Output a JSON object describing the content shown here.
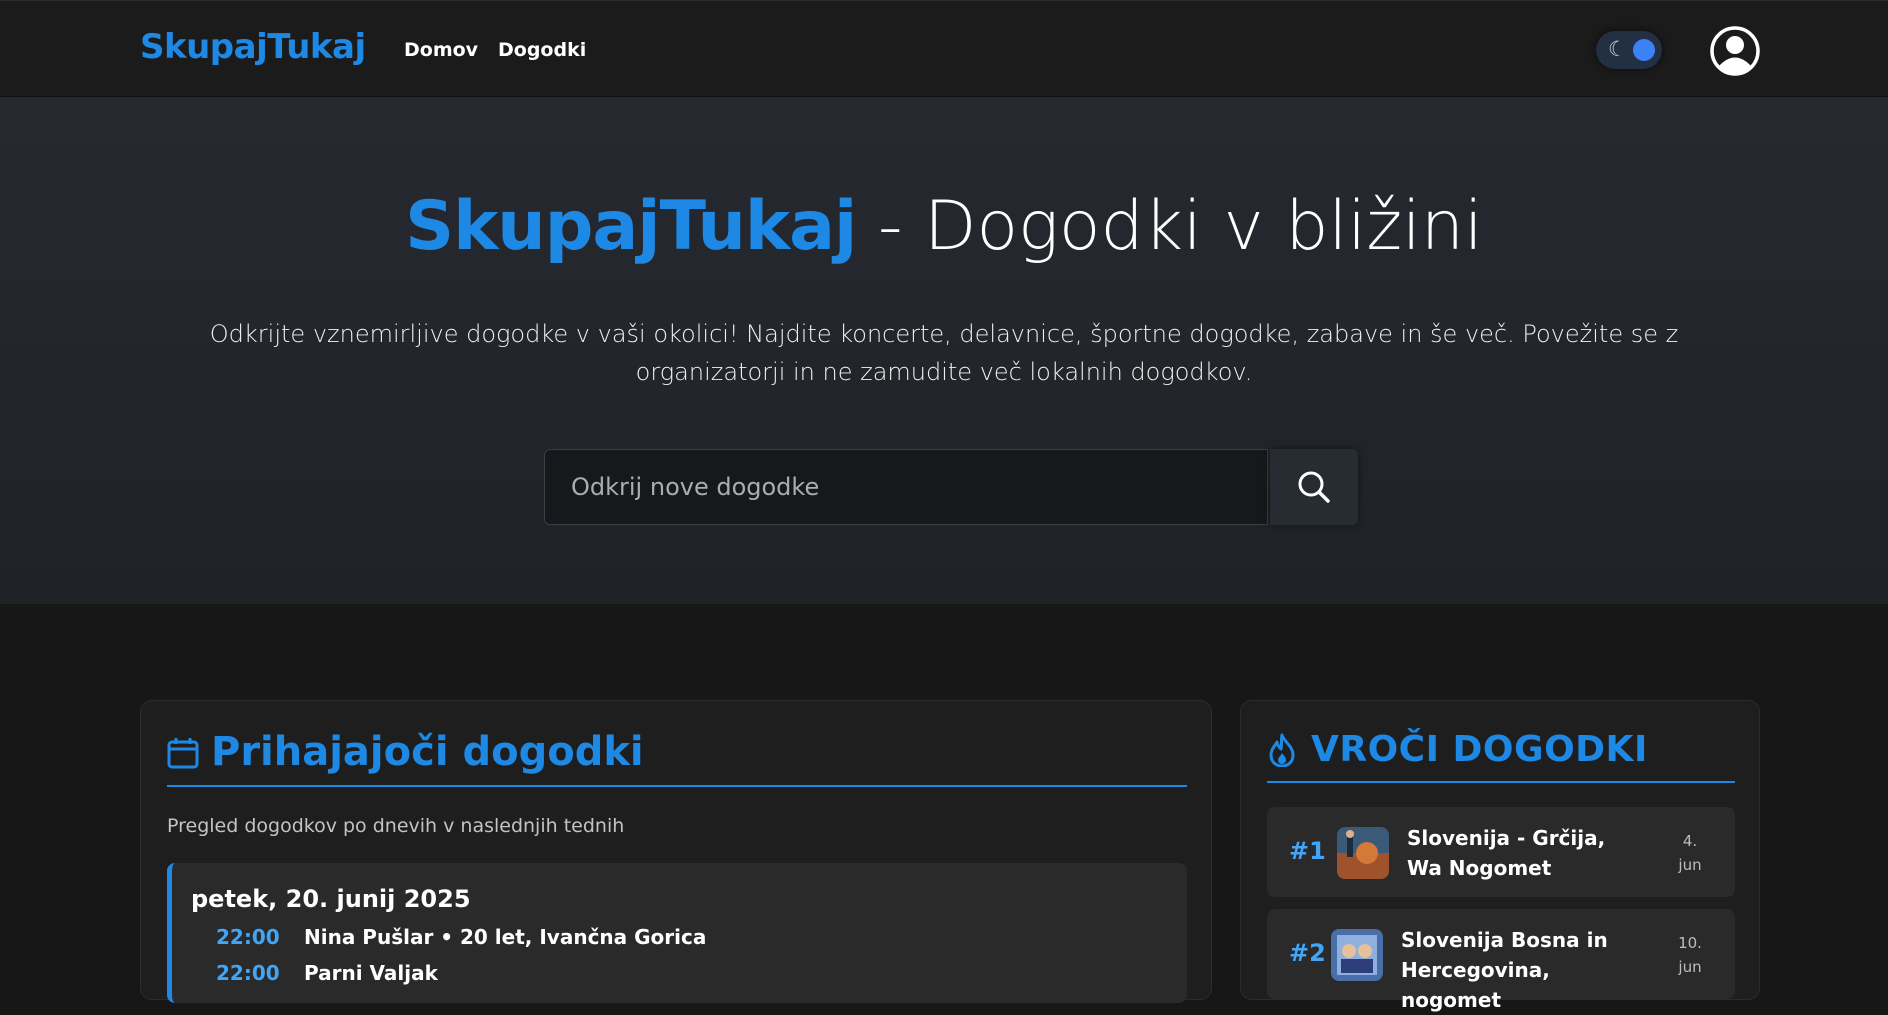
{
  "navbar": {
    "brand": "SkupajTukaj",
    "links": [
      "Domov",
      "Dogodki"
    ],
    "theme_toggle_icon": "moon-icon",
    "user_icon": "user-circle-icon"
  },
  "hero": {
    "title_brand": "SkupajTukaj",
    "title_rest": " - Dogodki v bližini",
    "description": "Odkrijte vznemirljive dogodke v vaši okolici! Najdite koncerte, delavnice, športne dogodke, zabave in še več. Povežite se z organizatorji in ne zamudite več lokalnih dogodkov.",
    "search_placeholder": "Odkrij nove dogodke",
    "search_button_icon": "search-icon"
  },
  "upcoming": {
    "title": "Prihajajoči dogodki",
    "icon": "calendar-icon",
    "subtitle": "Pregled dogodkov po dnevih v naslednjih tednih",
    "days": [
      {
        "date": "petek, 20. junij 2025",
        "events": [
          {
            "time": "22:00",
            "name": "Nina Pušlar • 20 let, Ivančna Gorica"
          },
          {
            "time": "22:00",
            "name": "Parni Valjak"
          }
        ]
      }
    ]
  },
  "hot": {
    "title": "VROČI DOGODKI",
    "icon": "flame-icon",
    "items": [
      {
        "rank": "#1",
        "name": "Slovenija - Grčija, Wa Nogomet",
        "day": "4.",
        "month": "jun"
      },
      {
        "rank": "#2",
        "name": "Slovenija Bosna in Hercegovina, nogomet",
        "day": "10.",
        "month": "jun"
      }
    ]
  },
  "colors": {
    "accent": "#1e88e5",
    "background": "#171717",
    "card": "#1e1e1e"
  }
}
